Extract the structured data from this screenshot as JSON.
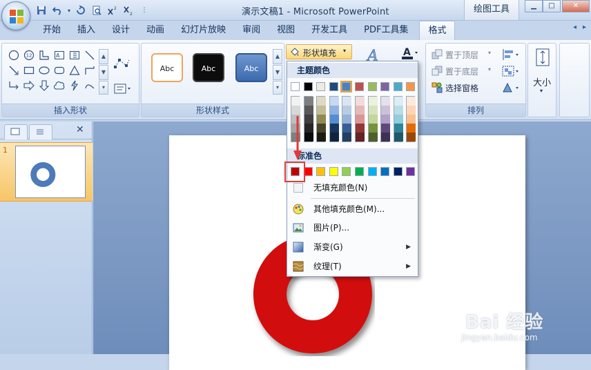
{
  "window": {
    "title": "演示文稿1 - Microsoft PowerPoint",
    "context_tab_title": "绘图工具"
  },
  "tabs": [
    "开始",
    "插入",
    "设计",
    "动画",
    "幻灯片放映",
    "审阅",
    "视图",
    "开发工具",
    "PDF工具集",
    "格式"
  ],
  "active_tab": "格式",
  "ribbon": {
    "groups": {
      "insert_shapes": "插入形状",
      "shape_styles": "形状样式",
      "arrange": "排列",
      "size": "大小"
    },
    "shape_style_swatches": [
      "Abc",
      "Abc",
      "Abc"
    ],
    "shape_fill_button": "形状填充",
    "arrange_buttons": {
      "bring_front": "置于顶层",
      "send_back": "置于底层",
      "selection_pane": "选择窗格"
    }
  },
  "fill_dropdown": {
    "theme_colors_header": "主题颜色",
    "standard_colors_header": "标准色",
    "theme_colors": [
      "#ffffff",
      "#000000",
      "#eeece1",
      "#1f497d",
      "#4f81bd",
      "#c0504d",
      "#9bbb59",
      "#8064a2",
      "#4bacc6",
      "#f79646"
    ],
    "theme_tints": [
      [
        "#f2f2f2",
        "#d8d8d8",
        "#bfbfbf",
        "#a5a5a5",
        "#7f7f7f"
      ],
      [
        "#7f7f7f",
        "#595959",
        "#3f3f3f",
        "#262626",
        "#0c0c0c"
      ],
      [
        "#ddd9c3",
        "#c4bd97",
        "#938953",
        "#494429",
        "#1d1b10"
      ],
      [
        "#c6d9f0",
        "#8db3e2",
        "#548dd4",
        "#17365d",
        "#0f243e"
      ],
      [
        "#dbe5f1",
        "#b8cce4",
        "#95b3d7",
        "#366092",
        "#244061"
      ],
      [
        "#f2dcdb",
        "#e5b9b7",
        "#d99694",
        "#953734",
        "#632423"
      ],
      [
        "#ebf1dd",
        "#d7e3bc",
        "#c3d69b",
        "#76923c",
        "#4f6128"
      ],
      [
        "#e5e0ec",
        "#ccc1d9",
        "#b2a2c7",
        "#5f497a",
        "#3f3151"
      ],
      [
        "#dbeef3",
        "#b7dde8",
        "#92cddc",
        "#31859b",
        "#205867"
      ],
      [
        "#fdeada",
        "#fbd5b5",
        "#fac08f",
        "#e36c09",
        "#974806"
      ]
    ],
    "standard_colors": [
      "#c00000",
      "#ff0000",
      "#ffc000",
      "#ffff00",
      "#92d050",
      "#00b050",
      "#00b0f0",
      "#0070c0",
      "#002060",
      "#7030a0"
    ],
    "items": {
      "no_fill": "无填充颜色(N)",
      "more_colors": "其他填充颜色(M)...",
      "picture": "图片(P)...",
      "gradient": "渐变(G)",
      "texture": "纹理(T)"
    }
  },
  "left_panel": {
    "slide_number": "1"
  },
  "watermark": {
    "text": "Bai 经验",
    "url": "jingyan.baidu.com"
  },
  "colors": {
    "donut": "#d20a0a",
    "highlight": "#e23a36"
  }
}
